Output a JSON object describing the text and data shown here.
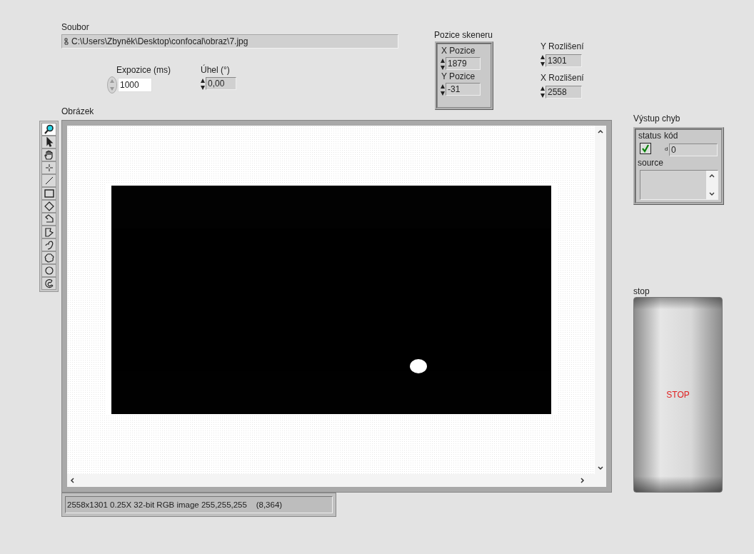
{
  "file_path": {
    "label": "Soubor",
    "value": "C:\\Users\\Zbyněk\\Desktop\\confocal\\obraz\\7.jpg"
  },
  "exposure": {
    "label": "Expozice (ms)",
    "value": "1000"
  },
  "angle": {
    "label": "Úhel (°)",
    "value": "0,00"
  },
  "scanner_position": {
    "label": "Pozice skeneru",
    "fields": [
      {
        "label": "X Pozice",
        "value": "1879"
      },
      {
        "label": "Y Pozice",
        "value": "-31"
      }
    ]
  },
  "y_resolution": {
    "label": "Y Rozlišení",
    "value": "1301"
  },
  "x_resolution": {
    "label": "X Rozlišení",
    "value": "2558"
  },
  "image_display": {
    "label": "Obrázek",
    "tools": [
      {
        "kind": "zoom",
        "selected": true
      },
      {
        "kind": "pointer",
        "selected": false
      },
      {
        "kind": "pan",
        "selected": false
      },
      {
        "kind": "point",
        "selected": false
      },
      {
        "kind": "line",
        "selected": false
      },
      {
        "kind": "rectangle",
        "selected": false
      },
      {
        "kind": "rotated_rectangle",
        "selected": false
      },
      {
        "kind": "polyline",
        "selected": false
      },
      {
        "kind": "polygon",
        "selected": false
      },
      {
        "kind": "freehand_line",
        "selected": false
      },
      {
        "kind": "freehand_region",
        "selected": false
      },
      {
        "kind": "oval",
        "selected": false
      },
      {
        "kind": "annulus",
        "selected": false
      }
    ],
    "status": "2558x1301 0.25X 32-bit RGB image 255,255,255    (8,364)"
  },
  "error_out": {
    "label": "Výstup chyb",
    "status_label": "status",
    "error": false,
    "code_label": "kód",
    "radix": "d",
    "code": "0",
    "source_label": "source"
  },
  "stop": {
    "label": "stop",
    "button": "STOP"
  }
}
